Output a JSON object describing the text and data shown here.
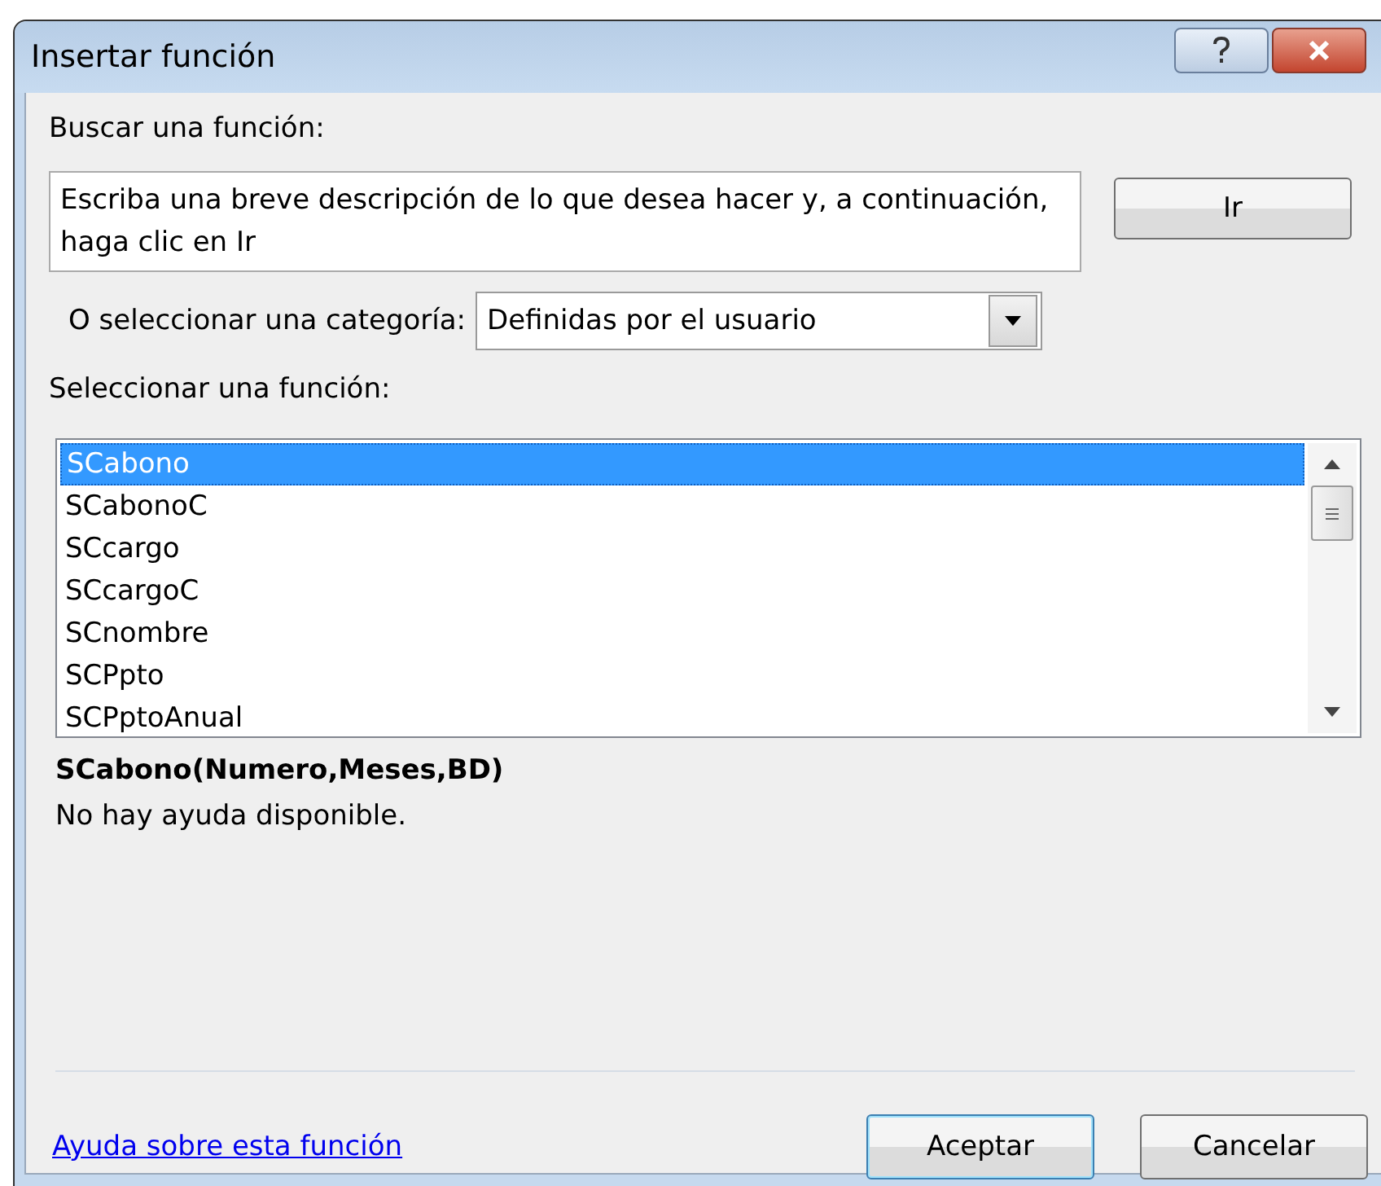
{
  "window": {
    "title": "Insertar función"
  },
  "search": {
    "label": "Buscar una función:",
    "placeholder": "Escriba una breve descripción de lo que desea hacer y, a continuación, haga clic en Ir",
    "button": "Ir"
  },
  "category": {
    "label": "O seleccionar una categoría:",
    "value": "Definidas por el usuario"
  },
  "functions": {
    "label": "Seleccionar una función:",
    "items": [
      {
        "name": "SCabono",
        "selected": true
      },
      {
        "name": "SCabonoC",
        "selected": false
      },
      {
        "name": "SCcargo",
        "selected": false
      },
      {
        "name": "SCcargoC",
        "selected": false
      },
      {
        "name": "SCnombre",
        "selected": false
      },
      {
        "name": "SCPpto",
        "selected": false
      },
      {
        "name": "SCPptoAnual",
        "selected": false
      }
    ]
  },
  "signature": "SCabono(Numero,Meses,BD)",
  "description": "No hay ayuda disponible.",
  "help_link": "Ayuda sobre esta función",
  "buttons": [
    {
      "label": "Aceptar",
      "default": true
    },
    {
      "label": "Cancelar",
      "default": false
    }
  ]
}
